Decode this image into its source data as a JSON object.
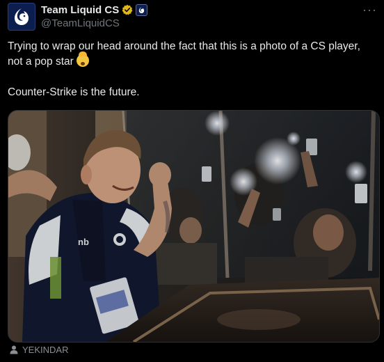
{
  "tweet": {
    "display_name": "Team Liquid CS",
    "handle": "@TeamLiquidCS",
    "more_label": "···",
    "text_line1": "Trying to wrap our head around the fact that this is a photo of a CS player, not a pop star",
    "text_line2": "Counter-Strike is the future.",
    "emoji": "exploding-head-emoji"
  },
  "media": {
    "jersey_text": "nb",
    "photo_credit": "YEKINDAR"
  },
  "colors": {
    "background": "#000000",
    "text": "#e7e9ea",
    "muted": "#71767b",
    "verified_gold": "#e2b719",
    "liquid_blue": "#0b1e4f"
  }
}
